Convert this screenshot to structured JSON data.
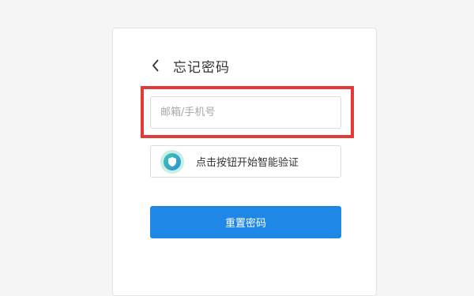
{
  "page": {
    "background": "#f5f5f5"
  },
  "header": {
    "back_icon": "chevron-left-icon",
    "title": "忘记密码"
  },
  "form": {
    "account_input": {
      "value": "",
      "placeholder": "邮箱/手机号",
      "highlight_color": "#e53935"
    },
    "captcha": {
      "icon": "shield-check-icon",
      "label": "点击按钮开始智能验证"
    },
    "submit_label": "重置密码",
    "accent_color": "#1f87e5"
  }
}
